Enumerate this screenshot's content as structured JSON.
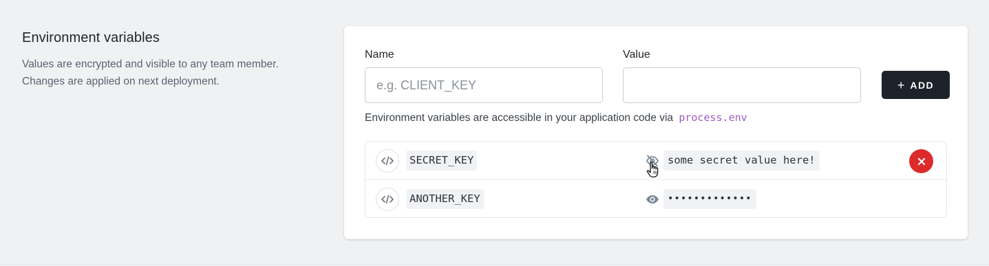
{
  "section": {
    "title": "Environment variables",
    "description_lines": [
      "Values are encrypted and visible to any team member.",
      "Changes are applied on next deployment."
    ]
  },
  "form": {
    "name_label": "Name",
    "name_placeholder": "e.g. CLIENT_KEY",
    "name_value": "",
    "value_label": "Value",
    "value_placeholder": "",
    "value_value": "",
    "add_button_label": "ADD",
    "add_button_icon": "plus-icon"
  },
  "helper": {
    "text": "Environment variables are accessible in your application code via",
    "code": "process.env"
  },
  "variables": [
    {
      "key": "SECRET_KEY",
      "value": "some secret value here!",
      "revealed": true,
      "visibility_icon": "eye-off-icon",
      "show_delete": true,
      "delete_icon": "close-icon"
    },
    {
      "key": "ANOTHER_KEY",
      "value": "•••••••••••••",
      "revealed": false,
      "visibility_icon": "eye-icon",
      "show_delete": false
    }
  ],
  "colors": {
    "page_bg": "#f0f1f3",
    "card_bg": "#ffffff",
    "button_dark": "#1d232b",
    "code_accent": "#a05cc4",
    "delete_red": "#dc2b2b",
    "icon_gray": "#7b8794"
  }
}
